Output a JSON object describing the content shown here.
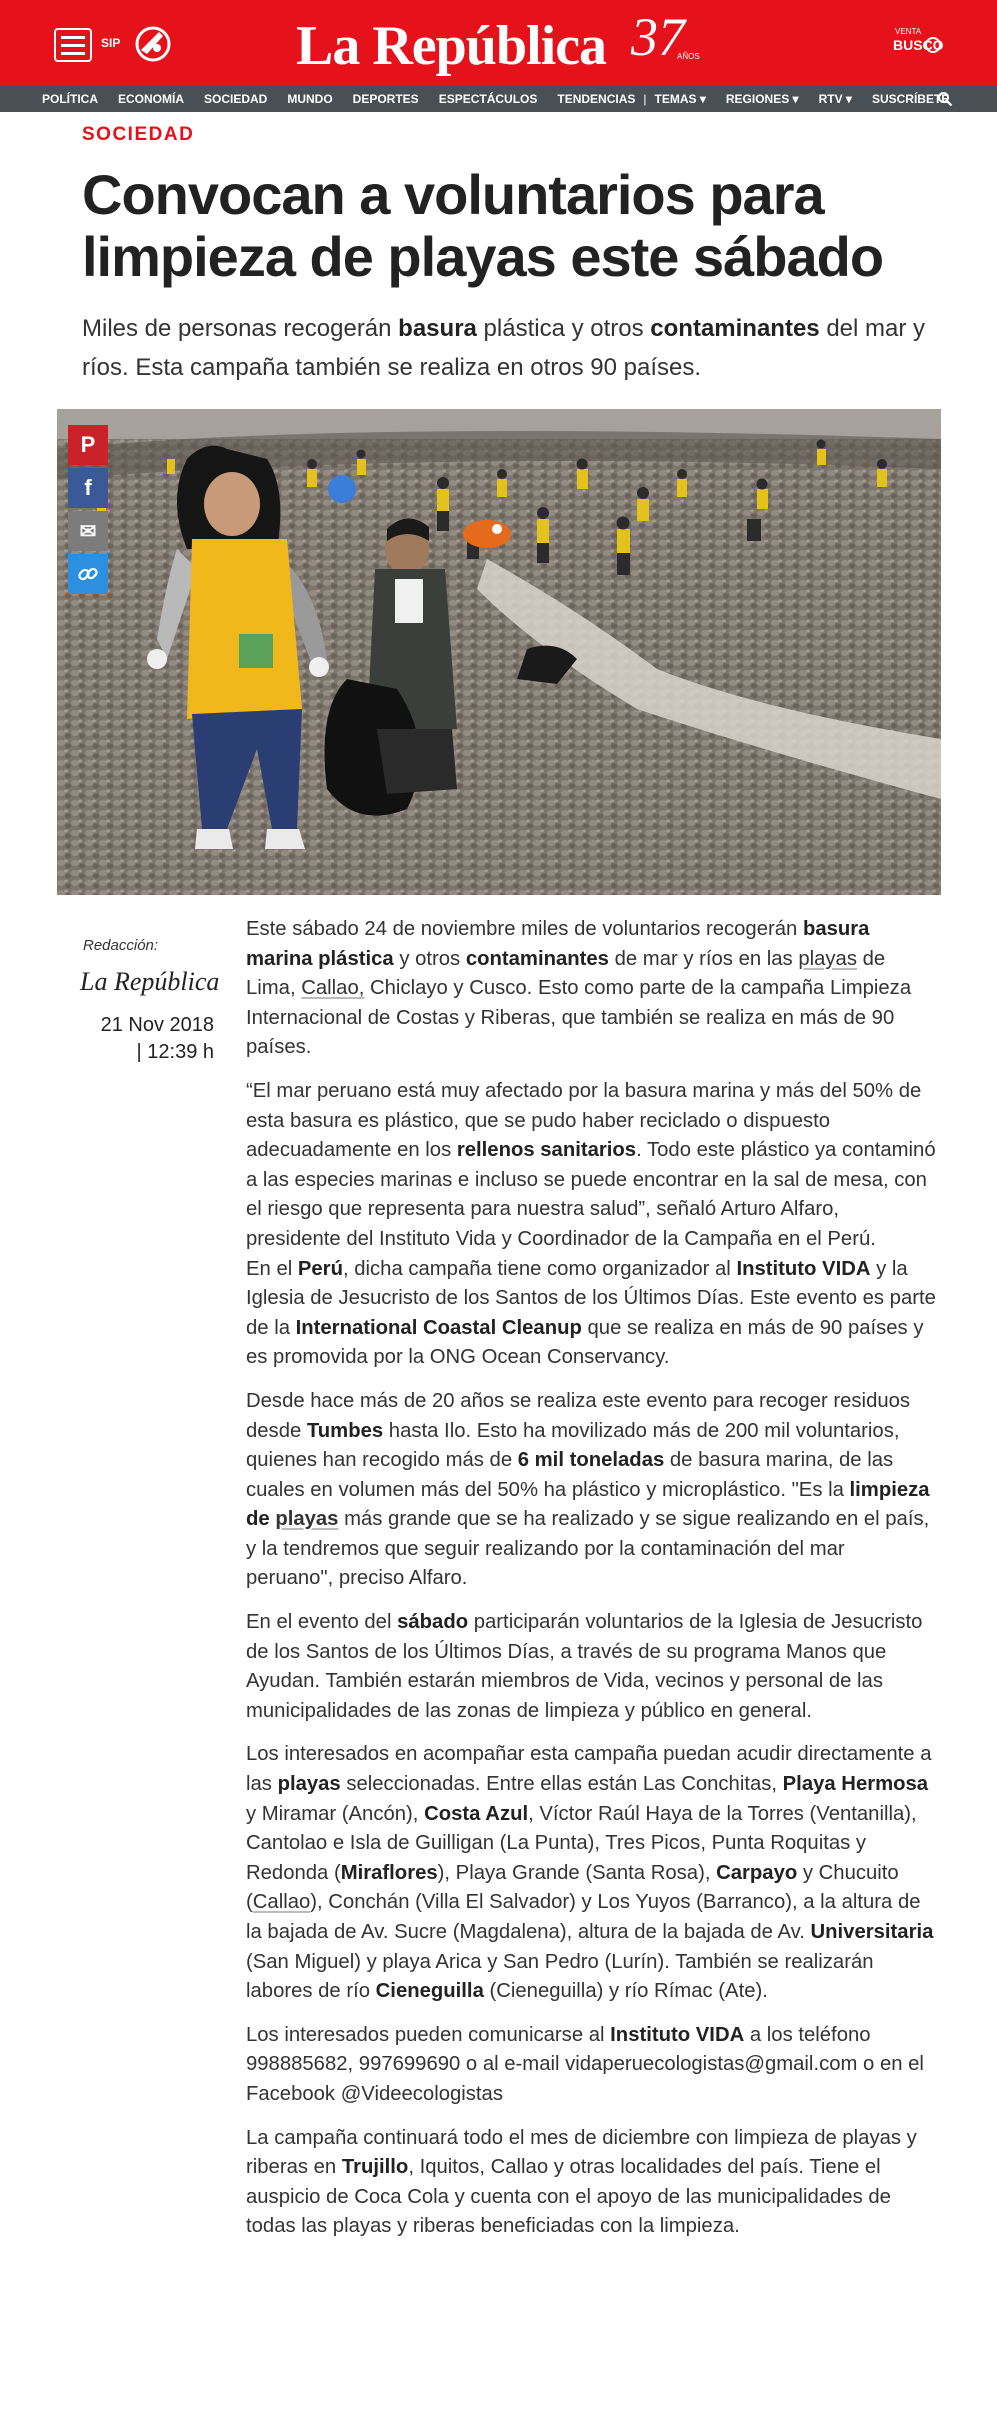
{
  "header": {
    "sip_label": "SIP",
    "brand": "La República",
    "anniversary_number": "37",
    "anniversary_sub": "AÑOS",
    "busco_small": "VENTA",
    "busco_big": "BUSCO"
  },
  "nav": {
    "items": [
      "POLÍTICA",
      "ECONOMÍA",
      "SOCIEDAD",
      "MUNDO",
      "DEPORTES",
      "ESPECTÁCULOS",
      "TENDENCIAS"
    ],
    "separator": "|",
    "temas": "TEMAS ▾",
    "regiones": "REGIONES ▾",
    "rtv": "RTV ▾",
    "suscribete": "SUSCRÍBETE"
  },
  "article": {
    "section": "SOCIEDAD",
    "title": "Convocan a voluntarios para limpieza de playas este sábado",
    "lead": {
      "t1": "Miles de personas recogerán ",
      "b1": "basura",
      "t2": " plástica y otros ",
      "b2": "contaminantes",
      "t3": " del mar y ríos. Esta campaña también se realiza en otros 90 países."
    },
    "byline_label": "Redacción:",
    "byline_org": "La República",
    "date": "21 Nov 2018",
    "time": "| 12:39 h"
  },
  "share": {
    "pinterest": "P",
    "facebook": "f",
    "email": "✉",
    "link": "🔗"
  },
  "body": {
    "p1": {
      "t1": "Este sábado 24 de noviembre miles de voluntarios recogerán ",
      "b1": "basura marina plástica",
      "t2": " y otros ",
      "b2": "contaminantes",
      "t3": " de mar y ríos en las ",
      "u1": "playas",
      "t4": " de Lima, ",
      "u2": "Callao,",
      "t5": " Chiclayo y Cusco. Esto como parte de la campaña Limpieza Internacional de Costas y Riberas, que también se realiza en más de 90 países."
    },
    "p2": {
      "t1": "“El mar peruano está muy afectado por la basura marina y más del 50% de esta basura es plástico, que se pudo haber reciclado  o dispuesto adecuadamente en los ",
      "b1": "rellenos sanitarios",
      "t2": ". Todo este plástico ya contaminó a las especies marinas e incluso se puede encontrar en la sal de mesa, con el riesgo que representa para nuestra salud”,  señaló Arturo Alfaro, presidente del Instituto Vida y Coordinador de la Campaña en el Perú."
    },
    "p3": {
      "t1": "En el ",
      "b1": "Perú",
      "t2": ", dicha campaña tiene como organizador al ",
      "b2": "Instituto VIDA",
      "t3": " y la Iglesia de Jesucristo de los Santos de los Últimos Días. Este evento es parte de la ",
      "b3": "International Coastal Cleanup",
      "t4": " que se realiza en más de 90 países y es promovida por la ONG Ocean Conservancy."
    },
    "p4": {
      "t1": "Desde hace más de 20 años se realiza este evento para recoger residuos desde ",
      "b1": "Tumbes",
      "t2": " hasta Ilo. Esto ha movilizado más de 200 mil voluntarios, quienes han recogido más de ",
      "b2": "6 mil toneladas",
      "t3": " de basura marina, de las cuales en volumen más del 50% ha plástico y microplástico. \"Es la ",
      "b3": "limpieza de ",
      "b3u": "playas",
      "t4": " más grande que se ha realizado y se sigue realizando en el país, y la tendremos que seguir realizando por la contaminación del mar peruano\", preciso Alfaro."
    },
    "p5": {
      "t1": "En el evento del ",
      "b1": "sábado",
      "t2": " participarán voluntarios de la Iglesia de Jesucristo de los Santos de los Últimos Días, a través de su programa Manos que Ayudan. También estarán miembros de Vida, vecinos y personal de las municipalidades de las zonas de limpieza y público en general."
    },
    "p6": {
      "t1": "Los interesados en acompañar esta campaña puedan acudir directamente a las ",
      "b1": "playas",
      "t2": " seleccionadas. Entre ellas están Las Conchitas, ",
      "b2": "Playa Hermosa",
      "t3": " y Miramar (Ancón), ",
      "b3": "Costa Azul",
      "t4": ", Víctor Raúl Haya de la Torres (Ventanilla), Cantolao e Isla de Guilligan (La Punta), Tres Picos, Punta Roquitas y Redonda (",
      "b4": "Miraflores",
      "t5": "), Playa Grande (Santa Rosa), ",
      "b5": "Carpayo",
      "t6": " y Chucuito (",
      "u1": "Callao",
      "t7": "), Conchán (Villa El Salvador) y Los Yuyos (Barranco), a la altura de la bajada de Av. Sucre (Magdalena), altura de la bajada de Av. ",
      "b6": "Universitaria",
      "t8": " (San Miguel) y playa Arica y San Pedro (Lurín). También se realizarán labores de río ",
      "b7": "Cieneguilla",
      "t9": " (Cieneguilla) y río Rímac (Ate)."
    },
    "p7": {
      "t1": "Los interesados pueden comunicarse al ",
      "b1": "Instituto VIDA",
      "t2": " a los teléfono 998885682, 997699690 o al e-mail vidaperuecologistas@gmail.com o en el Facebook @Videecologistas"
    },
    "p8": {
      "t1": "La campaña continuará todo el mes de diciembre con limpieza de playas y riberas en ",
      "b1": "Trujillo",
      "t2": ", Iquitos, Callao y otras localidades del país. Tiene el auspicio de Coca Cola y cuenta con el apoyo de las municipalidades de todas las playas y riberas beneficiadas con la limpieza."
    }
  },
  "colors": {
    "brand_red": "#e5121b",
    "nav_gray": "#4a4f55"
  }
}
